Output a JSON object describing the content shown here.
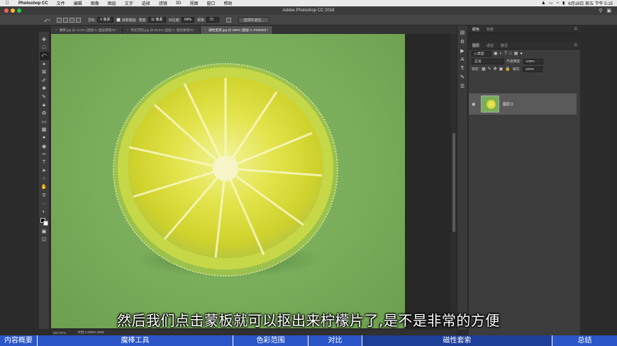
{
  "menubar": {
    "apple_icon": "apple-icon",
    "app_name": "Photoshop CC",
    "items": [
      "文件",
      "编辑",
      "图像",
      "图层",
      "文字",
      "选择",
      "滤镜",
      "3D",
      "视图",
      "窗口",
      "帮助"
    ],
    "clock": "6月18日 周五 下午 5:15"
  },
  "window": {
    "title": "Adobe Photoshop CC 2018",
    "traffic_colors": [
      "#ff5f57",
      "#febc2e",
      "#28c840"
    ]
  },
  "options": {
    "feather_label": "羽化:",
    "feather_value": "0 像素",
    "antialias_label": "消除锯齿",
    "width_label": "宽度:",
    "width_value": "11 像素",
    "contrast_label": "对比度:",
    "contrast_value": "64%",
    "frequency_label": "频率:",
    "frequency_value": "72",
    "select_mask_label": "选择并遮住..."
  },
  "tabs": [
    {
      "label": "魔棒.jpg @ 41.8% (图层 0, 图层蒙版/8) *",
      "active": false
    },
    {
      "label": "色彩范围.jpg @ 83.5% (图层 0, 图层蒙版/8) *",
      "active": false
    },
    {
      "label": "磁性套索.jpg @ 288% (图层 0, RGB/8#) *",
      "active": true
    }
  ],
  "status": {
    "zoom": "287.57%",
    "doc": "文档:1.83M/1.83M"
  },
  "panels": {
    "color_tabs": [
      "颜色",
      "色板"
    ],
    "layer_tabs": [
      "图层",
      "通道",
      "路径"
    ],
    "kind_label": "ρ 类型",
    "blend_mode": "正常",
    "opacity_label": "不透明度:",
    "opacity_value": "100%",
    "lock_label": "锁定:",
    "fill_label": "填充:",
    "fill_value": "100%",
    "layer_name": "图层 0"
  },
  "subtitle": "然后我们点击蒙板就可以抠出来柠檬片了,是不是非常的方便",
  "chapters": [
    {
      "label": "内容概要",
      "active": false
    },
    {
      "label": "魔棒工具",
      "active": false
    },
    {
      "label": "色彩范围",
      "active": false
    },
    {
      "label": "对比",
      "active": false
    },
    {
      "label": "磁性套索",
      "active": true
    },
    {
      "label": "总结",
      "active": false
    }
  ],
  "colors": {
    "chapter_bar": "#2a56c8",
    "canvas_bg": "#79ad5a",
    "lime": "#d8da2e"
  }
}
